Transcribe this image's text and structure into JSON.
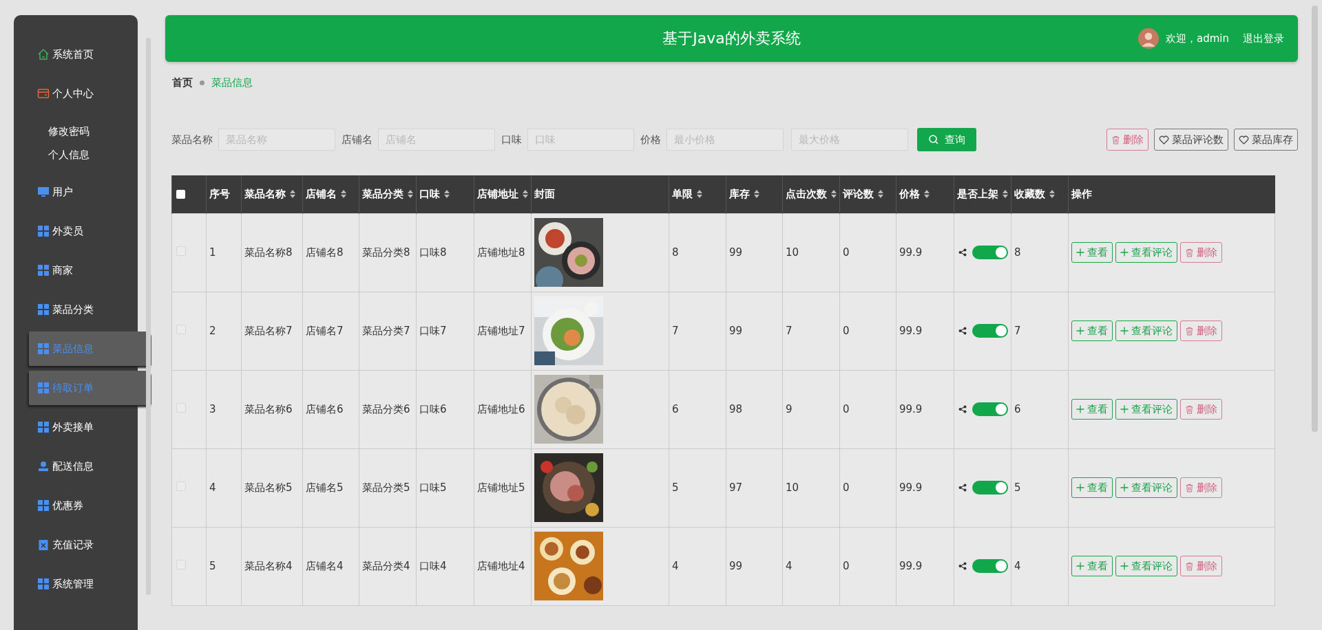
{
  "sidebar": {
    "items": [
      {
        "label": "系统首页",
        "kind": "home",
        "highlighted": false
      },
      {
        "label": "个人中心",
        "kind": "card",
        "highlighted": false,
        "children": [
          {
            "label": "修改密码"
          },
          {
            "label": "个人信息"
          }
        ]
      },
      {
        "label": "用户",
        "kind": "monitor",
        "highlighted": false
      },
      {
        "label": "外卖员",
        "kind": "grid",
        "highlighted": false
      },
      {
        "label": "商家",
        "kind": "grid",
        "highlighted": false
      },
      {
        "label": "菜品分类",
        "kind": "grid",
        "highlighted": false
      },
      {
        "label": "菜品信息",
        "kind": "grid",
        "highlighted": true
      },
      {
        "label": "待取订单",
        "kind": "grid",
        "highlighted": true
      },
      {
        "label": "外卖接单",
        "kind": "grid",
        "highlighted": false
      },
      {
        "label": "配送信息",
        "kind": "person",
        "highlighted": false
      },
      {
        "label": "优惠券",
        "kind": "grid",
        "highlighted": false
      },
      {
        "label": "充值记录",
        "kind": "clipboard",
        "highlighted": false
      },
      {
        "label": "系统管理",
        "kind": "grid",
        "highlighted": false
      }
    ]
  },
  "header": {
    "title": "基于Java的外卖系统",
    "welcome": "欢迎，admin",
    "logout": "退出登录"
  },
  "breadcrumb": [
    "首页",
    "菜品信息"
  ],
  "search": {
    "fields": [
      {
        "label": "菜品名称",
        "placeholder": "菜品名称"
      },
      {
        "label": "店铺名",
        "placeholder": "店铺名"
      },
      {
        "label": "口味",
        "placeholder": "口味"
      },
      {
        "label": "价格",
        "placeholder": "最小价格"
      },
      {
        "placeholder": "最大价格"
      }
    ],
    "query_button": "查询",
    "delete_button": "删除",
    "buttons": [
      "菜品评论数",
      "菜品库存"
    ]
  },
  "table": {
    "all_checked": false,
    "columns": [
      {
        "label": "序号",
        "sortable": false
      },
      {
        "label": "菜品名称",
        "sortable": true
      },
      {
        "label": "店铺名",
        "sortable": true
      },
      {
        "label": "菜品分类",
        "sortable": true
      },
      {
        "label": "口味",
        "sortable": true
      },
      {
        "label": "店铺地址",
        "sortable": true
      },
      {
        "label": "封面",
        "sortable": false
      },
      {
        "label": "单限",
        "sortable": true
      },
      {
        "label": "库存",
        "sortable": true
      },
      {
        "label": "点击次数",
        "sortable": true
      },
      {
        "label": "评论数",
        "sortable": true
      },
      {
        "label": "价格",
        "sortable": true
      },
      {
        "label": "是否上架",
        "sortable": true
      },
      {
        "label": "收藏数",
        "sortable": true
      },
      {
        "label": "操作",
        "sortable": false
      }
    ],
    "rows": [
      {
        "checked": false,
        "cells": [
          "1",
          "菜品名称8",
          "店铺名8",
          "菜品分类8",
          "口味8",
          "店铺地址8"
        ],
        "cover": {
          "kind": "picture"
        },
        "stats": [
          "8",
          "99",
          "10",
          "0",
          "99.9"
        ],
        "on": true,
        "favorites": "8",
        "actions": [
          "查看",
          "查看评论",
          "删除"
        ]
      },
      {
        "checked": false,
        "cells": [
          "2",
          "菜品名称7",
          "店铺名7",
          "菜品分类7",
          "口味7",
          "店铺地址7"
        ],
        "cover": {
          "kind": "picture"
        },
        "stats": [
          "7",
          "99",
          "7",
          "0",
          "99.9"
        ],
        "on": true,
        "favorites": "7",
        "actions": [
          "查看",
          "查看评论",
          "删除"
        ]
      },
      {
        "checked": false,
        "cells": [
          "3",
          "菜品名称6",
          "店铺名6",
          "菜品分类6",
          "口味6",
          "店铺地址6"
        ],
        "cover": {
          "kind": "picture"
        },
        "stats": [
          "6",
          "98",
          "9",
          "0",
          "99.9"
        ],
        "on": true,
        "favorites": "6",
        "actions": [
          "查看",
          "查看评论",
          "删除"
        ]
      },
      {
        "checked": false,
        "cells": [
          "4",
          "菜品名称5",
          "店铺名5",
          "菜品分类5",
          "口味5",
          "店铺地址5"
        ],
        "cover": {
          "kind": "picture"
        },
        "stats": [
          "5",
          "97",
          "10",
          "0",
          "99.9"
        ],
        "on": true,
        "favorites": "5",
        "actions": [
          "查看",
          "查看评论",
          "删除"
        ]
      },
      {
        "checked": false,
        "cells": [
          "5",
          "菜品名称4",
          "店铺名4",
          "菜品分类4",
          "口味4",
          "店铺地址4"
        ],
        "cover": {
          "kind": "picture"
        },
        "stats": [
          "4",
          "99",
          "4",
          "0",
          "99.9"
        ],
        "on": true,
        "favorites": "4",
        "actions": [
          "查看",
          "查看评论",
          "删除"
        ]
      }
    ]
  }
}
